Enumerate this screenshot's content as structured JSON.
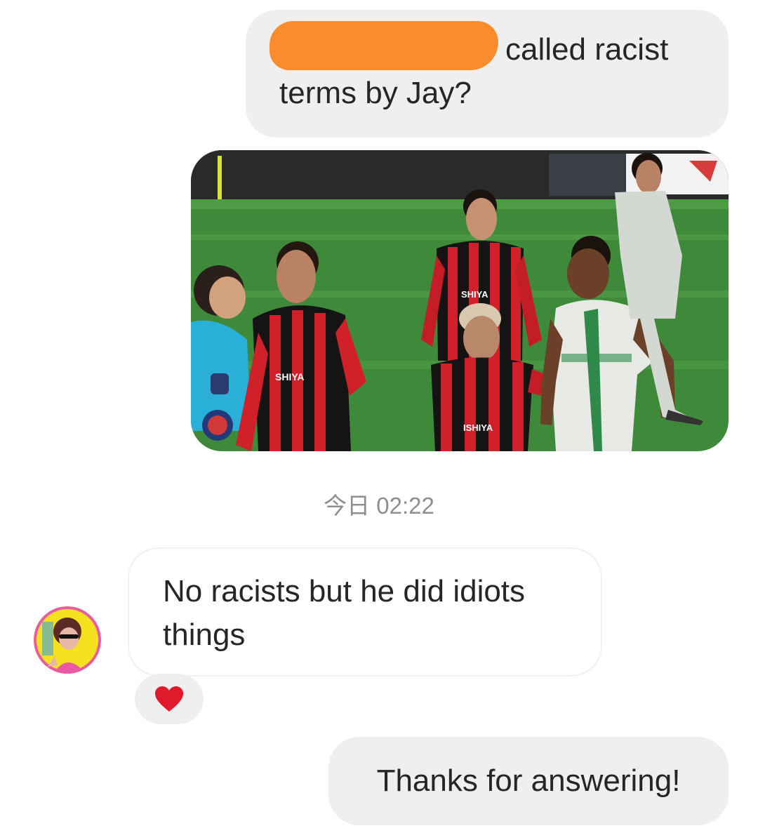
{
  "thread": {
    "message1": {
      "line1_tail": "called racist",
      "line2": "terms by Jay?"
    },
    "media_shirt_text": [
      "SHIYA",
      "SHIYA",
      "ISHIYA"
    ],
    "timestamp": "今日 02:22",
    "message2": {
      "line1": "No racists but he did idiots",
      "line2": "things",
      "reaction": "heart-icon"
    },
    "message3": "Thanks for answering!"
  },
  "colors": {
    "outgoing_bubble": "#efefef",
    "redaction": "#fb8c2e",
    "reaction_heart": "#e0192b",
    "timestamp_text": "#8e8e8e"
  }
}
